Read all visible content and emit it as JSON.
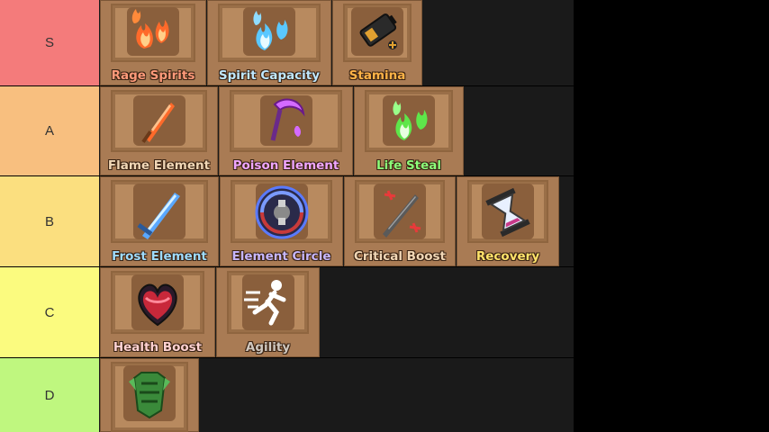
{
  "tiers": [
    {
      "label": "S",
      "color": "#f47b7b",
      "items": [
        {
          "name": "Rage Spirits",
          "color": "#ff9a7a",
          "icon": "fire-spirits-icon"
        },
        {
          "name": "Spirit Capacity",
          "color": "#bfe8ff",
          "icon": "blue-spirits-icon"
        },
        {
          "name": "Stamina",
          "color": "#ffb347",
          "icon": "battery-icon"
        }
      ]
    },
    {
      "label": "A",
      "color": "#f8bf7f",
      "items": [
        {
          "name": "Flame Element",
          "color": "#f1d7b6",
          "icon": "flame-sword-icon"
        },
        {
          "name": "Poison Element",
          "color": "#f0a6ff",
          "icon": "poison-scythe-icon"
        },
        {
          "name": "Life Steal",
          "color": "#8dff7a",
          "icon": "green-spirits-icon"
        }
      ]
    },
    {
      "label": "B",
      "color": "#fbdf7f",
      "items": [
        {
          "name": "Frost Element",
          "color": "#9fdcff",
          "icon": "ice-sword-icon"
        },
        {
          "name": "Element Circle",
          "color": "#c7b7ff",
          "icon": "element-circle-icon"
        },
        {
          "name": "Critical Boost",
          "color": "#f1d7b6",
          "icon": "critical-sword-icon"
        },
        {
          "name": "Recovery",
          "color": "#ffe36a",
          "icon": "hourglass-icon"
        }
      ]
    },
    {
      "label": "C",
      "color": "#fbfb7f",
      "items": [
        {
          "name": "Health Boost",
          "color": "#ffd2d2",
          "icon": "heart-icon"
        },
        {
          "name": "Agility",
          "color": "#d0c8bf",
          "icon": "running-figure-icon"
        }
      ]
    },
    {
      "label": "D",
      "color": "#bff77f",
      "items": [
        {
          "name": "",
          "color": "#9fdcff",
          "icon": "green-armor-icon"
        }
      ]
    }
  ]
}
